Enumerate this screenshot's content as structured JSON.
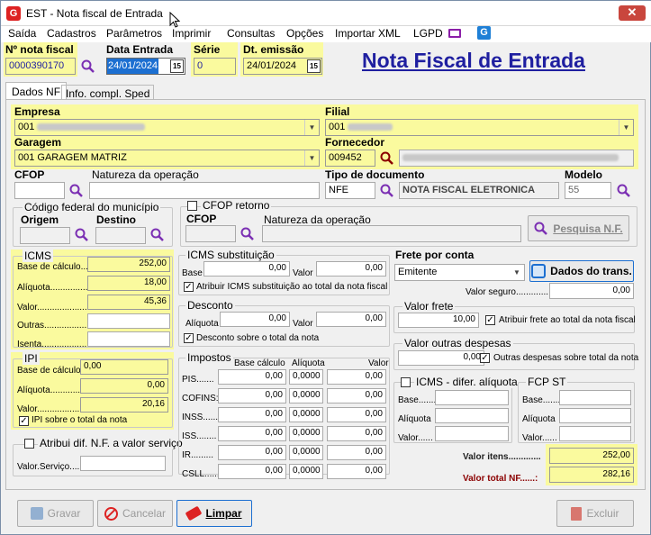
{
  "title": "EST - Nota fiscal de Entrada",
  "menu": [
    "Saída",
    "Cadastros",
    "Parâmetros",
    "Imprimir",
    "Consultas",
    "Opções",
    "Importar XML",
    "LGPD"
  ],
  "header": {
    "nf_label": "Nº nota fiscal",
    "nf_value": "0000390170",
    "data_entrada_label": "Data Entrada",
    "data_entrada_value": "24/01/2024",
    "serie_label": "Série",
    "serie_value": "0",
    "emissao_label": "Dt. emissão",
    "emissao_value": "24/01/2024",
    "page_title": "Nota Fiscal de Entrada"
  },
  "tabs": [
    "Dados NF",
    "Info. compl. Sped"
  ],
  "empresa": {
    "label": "Empresa",
    "value": "001"
  },
  "filial": {
    "label": "Filial",
    "value": "001"
  },
  "garagem": {
    "label": "Garagem",
    "value": "001 GARAGEM MATRIZ"
  },
  "fornecedor": {
    "label": "Fornecedor",
    "code": "009452"
  },
  "cfop": {
    "label": "CFOP",
    "nat_label": "Natureza da operação",
    "tipo_label": "Tipo de documento",
    "tipo_code": "NFE",
    "tipo_desc": "NOTA FISCAL ELETRONICA",
    "modelo_label": "Modelo",
    "modelo_value": "55"
  },
  "municipio": {
    "title": "Código federal do município",
    "origem": "Origem",
    "destino": "Destino"
  },
  "cfop_retorno": {
    "label": "CFOP retorno",
    "cfop": "CFOP",
    "nat": "Natureza da operação",
    "pesquisa": "Pesquisa N.F."
  },
  "icms": {
    "title": "ICMS",
    "base_label": "Base de cálculo...:",
    "base": "252,00",
    "aliq_label": "Alíquota..................",
    "aliq": "18,00",
    "valor_label": "Valor.........................",
    "valor": "45,36",
    "outras_label": "Outras.....................",
    "outras": "",
    "isenta_label": "Isenta.......................",
    "isenta": ""
  },
  "ipi": {
    "title": "IPI",
    "base_label": "Base de cálculo..:",
    "base": "0,00",
    "aliq_label": "Alíquota.................",
    "aliq": "0,00",
    "valor_label": "Valor.........................",
    "valor": "20,16",
    "chk_label": "IPI sobre o total da nota"
  },
  "dif": {
    "label": "Atribui dif. N.F. a valor serviço",
    "valor_label": "Valor.Serviço........"
  },
  "icms_sub": {
    "title": "ICMS substituição",
    "base": "Base",
    "base_v": "0,00",
    "valor": "Valor",
    "valor_v": "0,00",
    "chk": "Atribuir ICMS substituição ao total da nota fiscal"
  },
  "desconto": {
    "title": "Desconto",
    "aliq": "Alíquota",
    "aliq_v": "0,00",
    "valor": "Valor",
    "valor_v": "0,00",
    "chk": "Desconto sobre o total da nota"
  },
  "impostos": {
    "title": "Impostos",
    "h_base": "Base cálculo",
    "h_aliq": "Alíquota",
    "h_valor": "Valor",
    "rows": [
      {
        "n": "PIS.......",
        "b": "0,00",
        "a": "0,0000",
        "v": "0,00"
      },
      {
        "n": "COFINS:",
        "b": "0,00",
        "a": "0,0000",
        "v": "0,00"
      },
      {
        "n": "INSS......",
        "b": "0,00",
        "a": "0,0000",
        "v": "0,00"
      },
      {
        "n": "ISS........",
        "b": "0,00",
        "a": "0,0000",
        "v": "0,00"
      },
      {
        "n": "IR.........",
        "b": "0,00",
        "a": "0,0000",
        "v": "0,00"
      },
      {
        "n": "CSLL......",
        "b": "0,00",
        "a": "0,0000",
        "v": "0,00"
      }
    ]
  },
  "frete": {
    "label": "Frete por conta",
    "value": "Emitente",
    "dados": "Dados do trans.",
    "seguro_label": "Valor seguro.................",
    "seguro": "0,00"
  },
  "valor_frete": {
    "title": "Valor frete",
    "value": "10,00",
    "chk": "Atribuir frete ao total da nota fiscal"
  },
  "outras_desp": {
    "title": "Valor outras despesas",
    "value": "0,00",
    "chk": "Outras despesas sobre total da nota"
  },
  "icms_dif": {
    "title": "ICMS - difer. alíquota",
    "base": "Base.......",
    "aliq": "Alíquota",
    "valor": "Valor......"
  },
  "fcp": {
    "title": "FCP ST",
    "base": "Base.......",
    "aliq": "Alíquota",
    "valor": "Valor......"
  },
  "totais": {
    "itens_label": "Valor itens.............",
    "itens": "252,00",
    "nf_label": "Valor total NF......:",
    "nf": "282,16"
  },
  "buttons": {
    "gravar": "Gravar",
    "cancelar": "Cancelar",
    "limpar": "Limpar",
    "excluir": "Excluir"
  },
  "colors": {
    "accent": "#1f1fa0",
    "highlight": "#fafa9e",
    "total_red": "#8b0000"
  }
}
